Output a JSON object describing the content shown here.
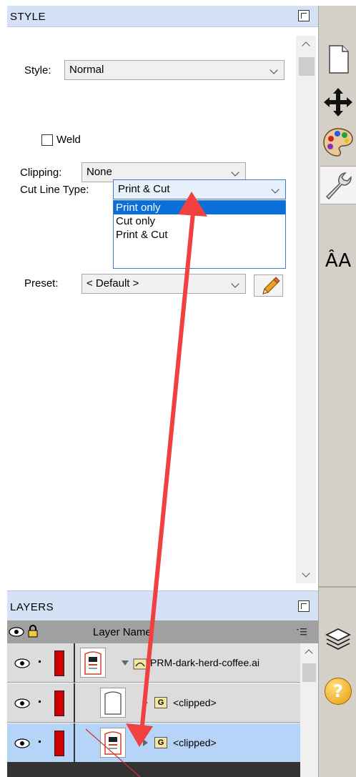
{
  "style_panel": {
    "title": "STYLE",
    "style_label": "Style:",
    "style_value": "Normal",
    "weld_label": "Weld",
    "weld_checked": false,
    "clipping_label": "Clipping:",
    "clipping_value": "None",
    "cut_line_label": "Cut Line Type:",
    "cut_line_value": "Print & Cut",
    "cut_line_options": [
      "Print only",
      "Cut only",
      "Print & Cut"
    ],
    "cut_line_highlighted": "Print only",
    "preset_label": "Preset:",
    "preset_value": "< Default >"
  },
  "layers_panel": {
    "title": "LAYERS",
    "column_header": "Layer Name",
    "rows": [
      {
        "name": "PRM-dark-herd-coffee.ai",
        "type": "file",
        "expanded": true,
        "selected": false
      },
      {
        "name": "<clipped>",
        "type": "group",
        "group_badge": "G",
        "expanded": false,
        "selected": false
      },
      {
        "name": "<clipped>",
        "type": "group",
        "group_badge": "G",
        "expanded": false,
        "selected": true
      }
    ]
  },
  "toolbar": {
    "icons": [
      "document-icon",
      "move-icon",
      "palette-icon",
      "wrench-icon",
      "text-size-icon",
      "layers-icon",
      "help-icon"
    ],
    "text_size_label": "ÂA",
    "help_label": "?"
  },
  "colors": {
    "panel_header": "#d5e2f5",
    "selection_blue": "#0a6fd6",
    "layer_color": "#d00000",
    "annotation_arrow": "#f04040"
  }
}
